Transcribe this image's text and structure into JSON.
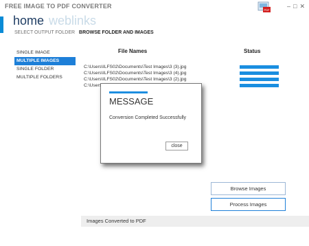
{
  "window": {
    "title": "FREE IMAGE TO PDF CONVERTER",
    "logo_icon": "pdf-app-logo-icon",
    "controls": {
      "minimize": "–",
      "maximize": "□",
      "close": "✕"
    }
  },
  "nav": {
    "tabs": [
      {
        "label": "home",
        "active": true
      },
      {
        "label": "weblinks",
        "active": false
      }
    ]
  },
  "subnav": {
    "items": [
      {
        "label": "SELECT OUTPUT FOLDER",
        "active": false
      },
      {
        "label": "BROWSE FOLDER AND IMAGES",
        "active": true
      }
    ]
  },
  "sidebar": {
    "items": [
      {
        "label": "SINGLE IMAGE",
        "active": false
      },
      {
        "label": "MULTIPLE IMAGES",
        "active": true
      },
      {
        "label": "SINGLE FOLDER",
        "active": false
      },
      {
        "label": "MULTIPLE FOLDERS",
        "active": false
      }
    ]
  },
  "table": {
    "headers": {
      "file_names": "File Names",
      "status": "Status"
    },
    "files": [
      "C:\\Users\\ILFS02\\Documents\\Test Images\\3 (3).jpg",
      "C:\\Users\\ILFS02\\Documents\\Test Images\\3 (4).jpg",
      "C:\\Users\\ILFS02\\Documents\\Test Images\\3 (2).jpg",
      "C:\\Users"
    ],
    "status_progress": [
      1.0,
      1.0,
      1.0,
      1.0
    ]
  },
  "dialog": {
    "title": "MESSAGE",
    "message": "Conversion Completed Successfully",
    "close_label": "close"
  },
  "actions": {
    "browse_label": "Browse Images",
    "process_label": "Process Images"
  },
  "statusbar": {
    "text": "Images Converted to PDF"
  },
  "colors": {
    "accent": "#1d8ee0",
    "nav_active": "#1f3d63",
    "nav_inactive": "#c9dbe8"
  }
}
